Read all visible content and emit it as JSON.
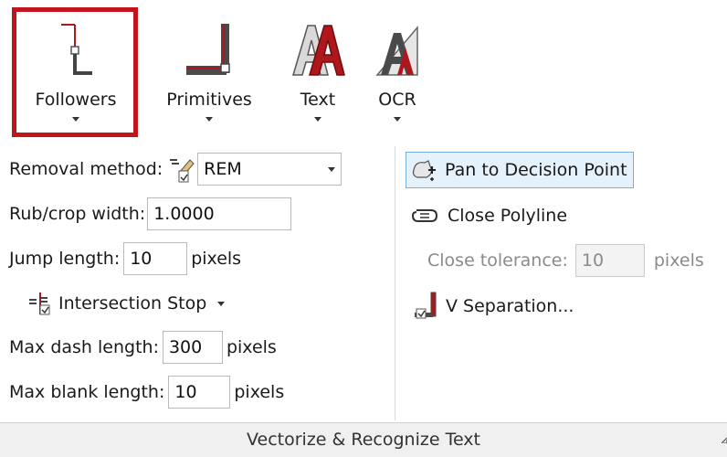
{
  "big_buttons": [
    {
      "label": "Followers",
      "icon": "followers-icon"
    },
    {
      "label": "Primitives",
      "icon": "primitives-icon"
    },
    {
      "label": "Text",
      "icon": "text-icon"
    },
    {
      "label": "OCR",
      "icon": "ocr-icon"
    }
  ],
  "left": {
    "removal_label": "Removal method:",
    "removal_value": "REM",
    "rub_label": "Rub/crop width:",
    "rub_value": "1.0000",
    "jump_label": "Jump length:",
    "jump_value": "10",
    "jump_unit": "pixels",
    "intersection_label": "Intersection Stop",
    "dash_label": "Max dash length:",
    "dash_value": "300",
    "dash_unit": "pixels",
    "blank_label": "Max blank length:",
    "blank_value": "10",
    "blank_unit": "pixels"
  },
  "right": {
    "pan_label": "Pan to Decision Point",
    "close_polyline_label": "Close Polyline",
    "tolerance_label": "Close tolerance:",
    "tolerance_value": "10",
    "tolerance_unit": "pixels",
    "vsep_label": "V Separation..."
  },
  "group_title": "Vectorize & Recognize Text",
  "colors": {
    "highlight": "#c0161b",
    "accent_red": "#b0171c"
  }
}
